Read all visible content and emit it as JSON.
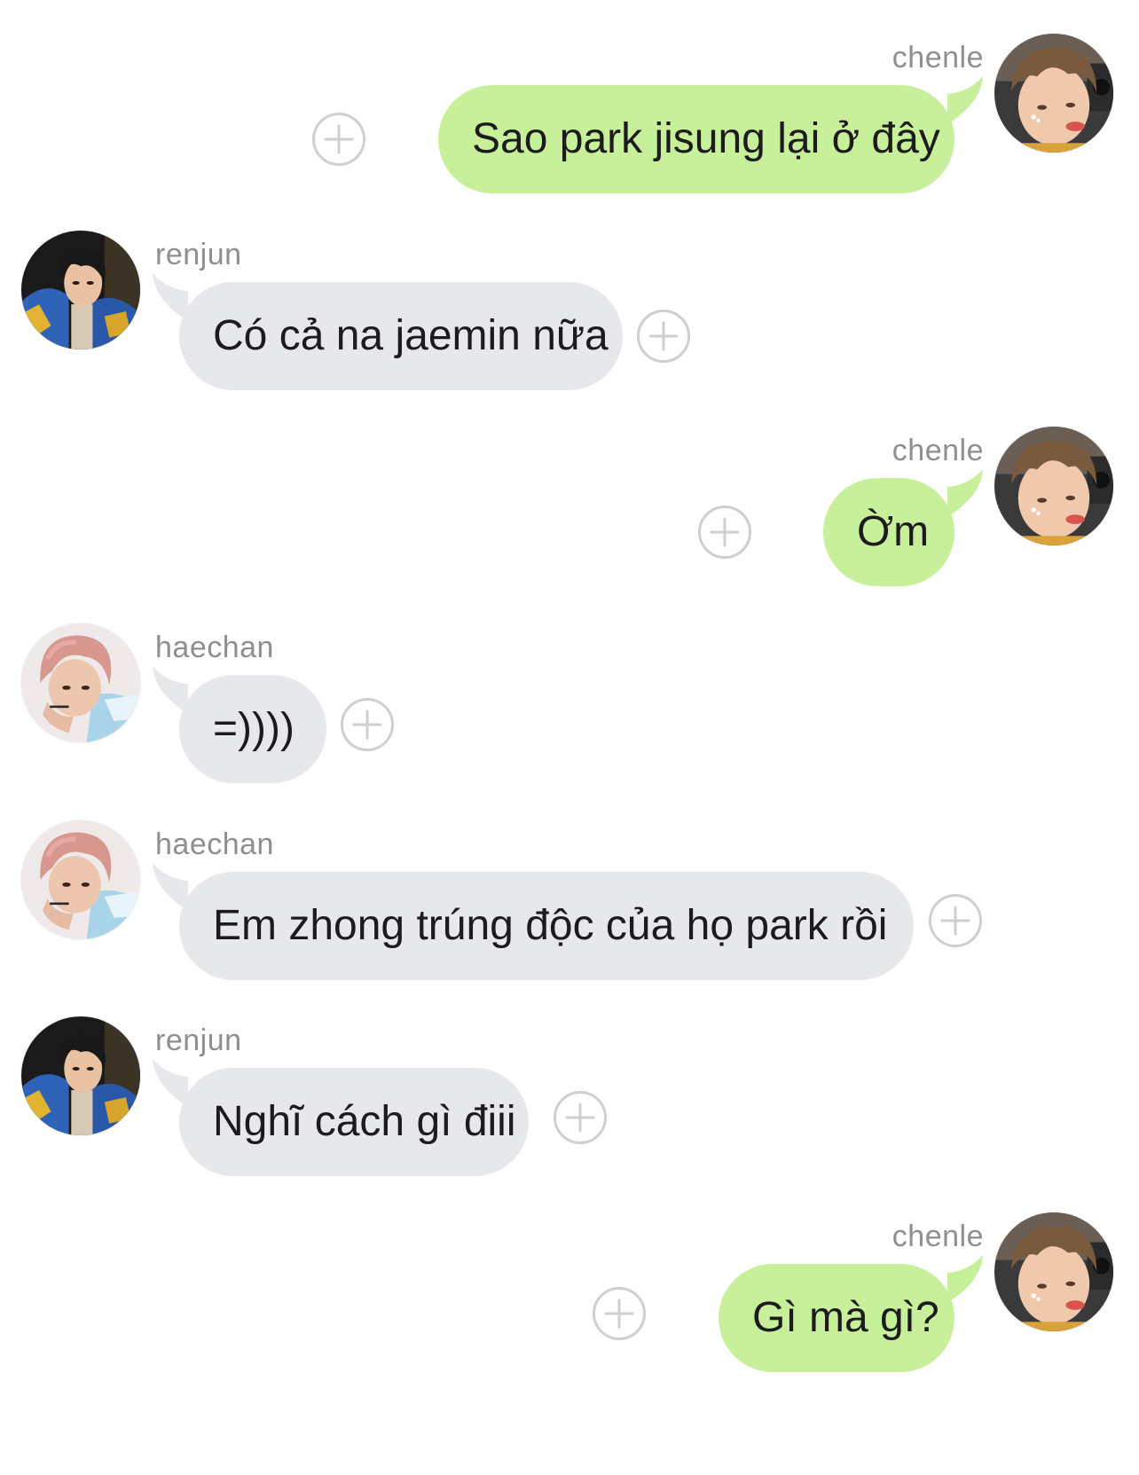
{
  "colors": {
    "incoming_bubble": "#e6e8eb",
    "outgoing_bubble": "#c8f09a",
    "sender_name": "#8e8e93",
    "add_button_border": "#cfcfd3"
  },
  "icons": {
    "add": "plus-circle-icon",
    "avatar": "user-avatar-photo"
  },
  "messages": [
    {
      "sender": "chenle",
      "side": "right",
      "text": "Sao park jisung lại ở đây"
    },
    {
      "sender": "renjun",
      "side": "left",
      "text": "Có cả na jaemin nữa"
    },
    {
      "sender": "chenle",
      "side": "right",
      "text": "Ờm"
    },
    {
      "sender": "haechan",
      "side": "left",
      "text": "=))))"
    },
    {
      "sender": "haechan",
      "side": "left",
      "text": "Em zhong trúng độc của họ park rồi"
    },
    {
      "sender": "renjun",
      "side": "left",
      "text": "Nghĩ cách gì điii"
    },
    {
      "sender": "chenle",
      "side": "right",
      "text": "Gì mà gì?"
    }
  ]
}
